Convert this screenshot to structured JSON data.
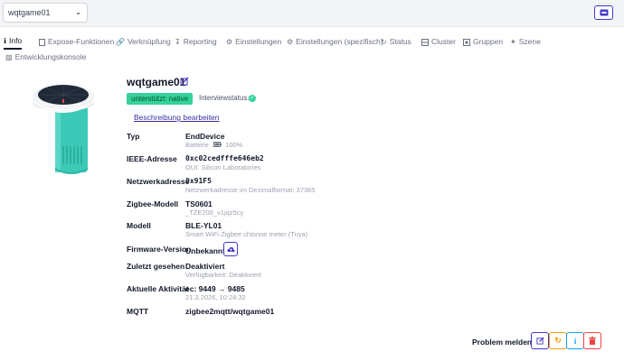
{
  "topbar": {
    "device_select": "wqtgame01",
    "device_select_icon": "chevron-down-icon",
    "action_icon": "inbox-icon",
    "accent": "#4338ca"
  },
  "tabs": [
    {
      "label": "Info",
      "icon": "info-icon",
      "active": true
    },
    {
      "label": "Expose-Funktionen",
      "icon": "document-icon"
    },
    {
      "label": "Verknüpfung",
      "icon": "link-icon"
    },
    {
      "label": "Reporting",
      "icon": "download-icon"
    },
    {
      "label": "Einstellungen",
      "icon": "cogs-icon"
    },
    {
      "label": "Einstellungen (spezifisch)",
      "icon": "gear-icon"
    },
    {
      "label": "Status",
      "icon": "status-icon"
    },
    {
      "label": "Cluster",
      "icon": "cluster-icon"
    },
    {
      "label": "Gruppen",
      "icon": "group-icon"
    },
    {
      "label": "Szene",
      "icon": "magic-wand-icon"
    },
    {
      "label": "Entwicklungskonsole",
      "icon": "code-icon"
    }
  ],
  "device": {
    "name": "wqtgame01",
    "support_badge": "unterstützt: native",
    "support_badge_color": "#34d399",
    "interview_label": "Interviewstatus:",
    "interview_icon": "check-circle-icon",
    "edit_description_link": "Beschreibung bearbeiten"
  },
  "details": [
    {
      "label": "Typ",
      "value": "EndDevice",
      "sub": "Batterie",
      "sub_extra": "100%",
      "sub_icon": "battery-icon"
    },
    {
      "label": "IEEE-Adresse",
      "value": "0xc02cedfffe646eb2",
      "sub": "OUI: Silicon Laboratories"
    },
    {
      "label": "Netzwerkadresse",
      "value": "0x91F5",
      "sub": "Netzwerkadresse im Dezimalformat: 37365"
    },
    {
      "label": "Zigbee-Modell",
      "value": "TS0601",
      "sub": "_TZE200_v1jqz5cy"
    },
    {
      "label": "Modell",
      "value": "BLE-YL01",
      "sub": "Smart WiFi Zigbee chlorine meter (Tuya)"
    },
    {
      "label": "Firmware-Version",
      "value": "Unbekannt",
      "button_icon": "cloud-upload-icon"
    },
    {
      "label": "Zuletzt gesehen",
      "value": "Deaktiviert",
      "sub": "Verfügbarkeit: Deaktiviert"
    },
    {
      "label": "Aktuelle Aktivität",
      "value": "ec: 9449 → 9485",
      "sub": "21.3.2026, 10:24:32"
    },
    {
      "label": "MQTT",
      "value": "zigbee2mqtt/wqtgame01"
    }
  ],
  "footer": {
    "problem_label": "Problem melden",
    "buttons": [
      {
        "icon": "edit-icon",
        "color": "#4338ca"
      },
      {
        "icon": "refresh-icon",
        "color": "#f59e0b"
      },
      {
        "icon": "info-icon",
        "color": "#0ea5e9"
      },
      {
        "icon": "trash-icon",
        "color": "#ef4444"
      }
    ]
  }
}
